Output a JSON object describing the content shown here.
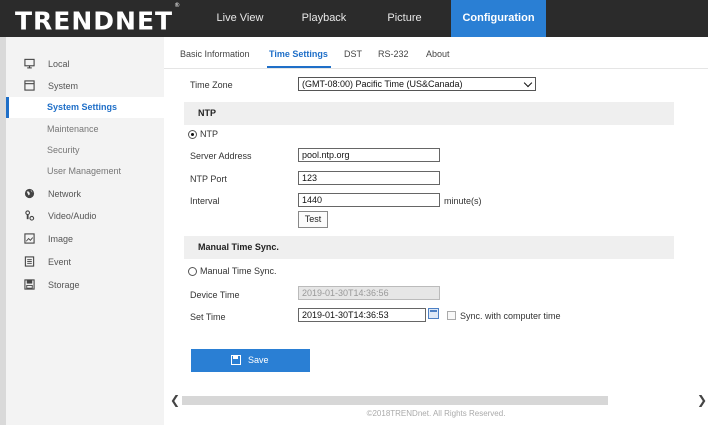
{
  "brand": {
    "logo": "TRENDNET",
    "trademark": "®"
  },
  "nav": {
    "tabs": [
      {
        "label": "Live View"
      },
      {
        "label": "Playback"
      },
      {
        "label": "Picture"
      },
      {
        "label": "Configuration",
        "active": true
      }
    ]
  },
  "sidebar": {
    "items": [
      {
        "label": "Local",
        "icon": "monitor-icon"
      },
      {
        "label": "System",
        "icon": "system-icon"
      },
      {
        "label": "System Settings",
        "sub": true,
        "active": true
      },
      {
        "label": "Maintenance",
        "sub": true
      },
      {
        "label": "Security",
        "sub": true
      },
      {
        "label": "User Management",
        "sub": true
      },
      {
        "label": "Network",
        "icon": "globe-icon"
      },
      {
        "label": "Video/Audio",
        "icon": "video-audio-icon"
      },
      {
        "label": "Image",
        "icon": "image-icon"
      },
      {
        "label": "Event",
        "icon": "event-icon"
      },
      {
        "label": "Storage",
        "icon": "storage-icon"
      }
    ]
  },
  "subtabs": [
    {
      "label": "Basic Information"
    },
    {
      "label": "Time Settings",
      "active": true
    },
    {
      "label": "DST"
    },
    {
      "label": "RS-232"
    },
    {
      "label": "About"
    }
  ],
  "form": {
    "time_zone_label": "Time Zone",
    "time_zone_value": "(GMT-08:00) Pacific Time (US&Canada)",
    "ntp_section": "NTP",
    "ntp_radio_label": "NTP",
    "server_address_label": "Server Address",
    "server_address_value": "pool.ntp.org",
    "ntp_port_label": "NTP Port",
    "ntp_port_value": "123",
    "interval_label": "Interval",
    "interval_value": "1440",
    "interval_unit": "minute(s)",
    "test_button": "Test",
    "manual_section": "Manual Time Sync.",
    "manual_radio_label": "Manual Time Sync.",
    "device_time_label": "Device Time",
    "device_time_value": "2019-01-30T14:36:56",
    "set_time_label": "Set Time",
    "set_time_value": "2019-01-30T14:36:53",
    "sync_computer_label": "Sync. with computer time",
    "save_button": "Save"
  },
  "footer": "©2018TRENDnet. All Rights Reserved.",
  "colors": {
    "accent": "#2a7fd4",
    "topbar": "#2b2b2b",
    "sidebar": "#f3f3f3"
  }
}
